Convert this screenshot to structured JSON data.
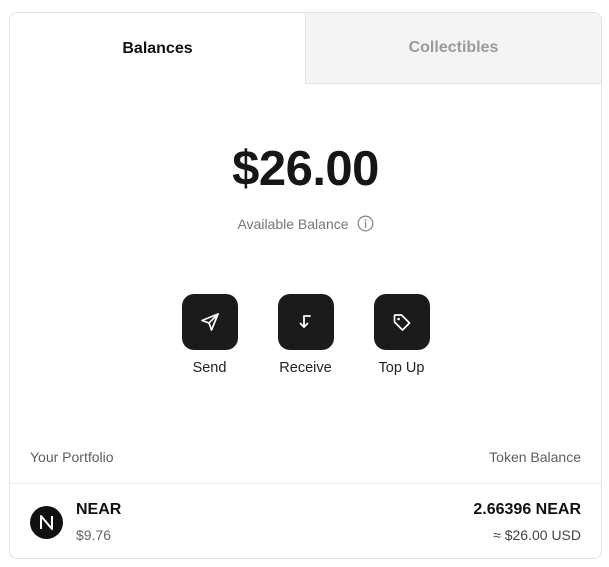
{
  "tabs": [
    {
      "label": "Balances",
      "active": true
    },
    {
      "label": "Collectibles",
      "active": false
    }
  ],
  "balance": {
    "amount": "$26.00",
    "label": "Available Balance",
    "info_icon": "info-circle-icon"
  },
  "actions": [
    {
      "label": "Send",
      "icon": "send-icon"
    },
    {
      "label": "Receive",
      "icon": "receive-arrow-icon"
    },
    {
      "label": "Top Up",
      "icon": "tag-icon"
    }
  ],
  "portfolio": {
    "left_header": "Your Portfolio",
    "right_header": "Token Balance",
    "tokens": [
      {
        "name": "NEAR",
        "price": "$9.76",
        "amount": "2.66396 NEAR",
        "usd": "≈ $26.00 USD",
        "icon": "near-logo-icon"
      }
    ]
  },
  "colors": {
    "button_bg": "#1b1b1b",
    "inactive_tab_bg": "#f4f4f4",
    "inactive_tab_text": "#9a9a9a"
  }
}
